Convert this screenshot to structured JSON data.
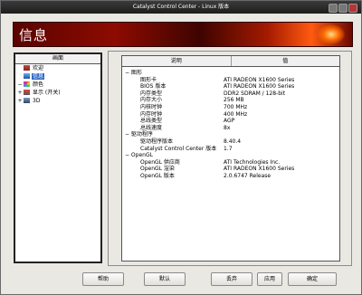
{
  "window": {
    "title": "Catalyst Control Center - Linux 版本"
  },
  "banner": {
    "title": "信息"
  },
  "tree": {
    "header": "画面",
    "items": [
      {
        "label": "欢迎",
        "expander": "",
        "selected": false,
        "indent": 0
      },
      {
        "label": "信息",
        "expander": "",
        "selected": true,
        "indent": 0
      },
      {
        "label": "颜色",
        "expander": "−",
        "selected": false,
        "indent": -1
      },
      {
        "label": "显示 (开关)",
        "expander": "+",
        "selected": false,
        "indent": -1
      },
      {
        "label": "3D",
        "expander": "+",
        "selected": false,
        "indent": -1
      }
    ]
  },
  "table": {
    "columns": [
      "说明",
      "值"
    ],
    "rows": [
      {
        "k": "图形",
        "v": "",
        "level": 0,
        "exp": "−"
      },
      {
        "k": "图形卡",
        "v": "ATI RADEON X1600 Series",
        "level": 1
      },
      {
        "k": "BIOS 版本",
        "v": "ATI RADEON X1600 Series",
        "level": 1
      },
      {
        "k": "内存类型",
        "v": "DDR2 SDRAM / 128-bit",
        "level": 1
      },
      {
        "k": "内存大小",
        "v": "256 MB",
        "level": 1
      },
      {
        "k": "内核时钟",
        "v": "700 MHz",
        "level": 1
      },
      {
        "k": "内存时钟",
        "v": "400 MHz",
        "level": 1
      },
      {
        "k": "总线类型",
        "v": "AGP",
        "level": 1
      },
      {
        "k": "总线速度",
        "v": "8x",
        "level": 1
      },
      {
        "k": "驱动程序",
        "v": "",
        "level": 0,
        "exp": "−"
      },
      {
        "k": "驱动程序版本",
        "v": "8.40.4",
        "level": 1
      },
      {
        "k": "Catalyst Control Center 版本",
        "v": "1.7",
        "level": 1
      },
      {
        "k": "OpenGL",
        "v": "",
        "level": 0,
        "exp": "−"
      },
      {
        "k": "OpenGL 供应商",
        "v": "ATI Technologies Inc.",
        "level": 1
      },
      {
        "k": "OpenGL 渲染",
        "v": "ATI RADEON X1600 Series",
        "level": 1
      },
      {
        "k": "OpenGL 版本",
        "v": "2.0.6747 Release",
        "level": 1
      }
    ]
  },
  "buttons": {
    "help": "帮助",
    "defaults": "默认",
    "discard": "丢弃",
    "apply": "应用",
    "ok": "确定"
  }
}
